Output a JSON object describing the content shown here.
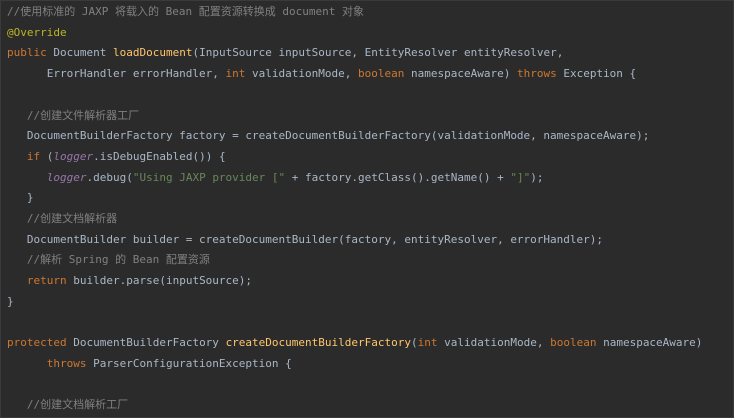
{
  "editor": {
    "colors": {
      "background": "#2b2b2b",
      "plain": "#a9b7c6",
      "comment": "#808080",
      "keyword": "#cc7832",
      "annotation": "#bbb529",
      "method": "#ffc66d",
      "string": "#6a8759",
      "field": "#9876aa"
    },
    "lines": [
      {
        "tokens": [
          {
            "t": "comment",
            "v": "//使用标准的 JAXP 将载入的 Bean 配置资源转换成 document 对象"
          }
        ]
      },
      {
        "tokens": [
          {
            "t": "annotation",
            "v": "@Override"
          }
        ]
      },
      {
        "tokens": [
          {
            "t": "keyword",
            "v": "public "
          },
          {
            "t": "plain",
            "v": "Document "
          },
          {
            "t": "method",
            "v": "loadDocument"
          },
          {
            "t": "plain",
            "v": "(InputSource inputSource, EntityResolver entityResolver,"
          }
        ]
      },
      {
        "tokens": [
          {
            "t": "plain",
            "v": "      ErrorHandler errorHandler, "
          },
          {
            "t": "keyword",
            "v": "int "
          },
          {
            "t": "plain",
            "v": "validationMode, "
          },
          {
            "t": "keyword",
            "v": "boolean "
          },
          {
            "t": "plain",
            "v": "namespaceAware) "
          },
          {
            "t": "keyword",
            "v": "throws "
          },
          {
            "t": "plain",
            "v": "Exception {"
          }
        ]
      },
      {
        "tokens": []
      },
      {
        "tokens": [
          {
            "t": "comment",
            "v": "   //创建文件解析器工厂"
          }
        ]
      },
      {
        "tokens": [
          {
            "t": "plain",
            "v": "   DocumentBuilderFactory factory = createDocumentBuilderFactory(validationMode, namespaceAware);"
          }
        ]
      },
      {
        "tokens": [
          {
            "t": "keyword",
            "v": "   if "
          },
          {
            "t": "plain",
            "v": "("
          },
          {
            "t": "field",
            "v": "logger"
          },
          {
            "t": "plain",
            "v": ".isDebugEnabled()) {"
          }
        ]
      },
      {
        "tokens": [
          {
            "t": "field",
            "v": "      logger"
          },
          {
            "t": "plain",
            "v": ".debug("
          },
          {
            "t": "string",
            "v": "\"Using JAXP provider [\""
          },
          {
            "t": "plain",
            "v": " + factory.getClass().getName() + "
          },
          {
            "t": "string",
            "v": "\"]\""
          },
          {
            "t": "plain",
            "v": ");"
          }
        ]
      },
      {
        "tokens": [
          {
            "t": "plain",
            "v": "   }"
          }
        ]
      },
      {
        "tokens": [
          {
            "t": "comment",
            "v": "   //创建文档解析器"
          }
        ]
      },
      {
        "tokens": [
          {
            "t": "plain",
            "v": "   DocumentBuilder builder = createDocumentBuilder(factory, entityResolver, errorHandler);"
          }
        ]
      },
      {
        "tokens": [
          {
            "t": "comment",
            "v": "   //解析 Spring 的 Bean 配置资源"
          }
        ]
      },
      {
        "tokens": [
          {
            "t": "keyword",
            "v": "   return "
          },
          {
            "t": "plain",
            "v": "builder.parse(inputSource);"
          }
        ]
      },
      {
        "tokens": [
          {
            "t": "plain",
            "v": "}"
          }
        ]
      },
      {
        "tokens": []
      },
      {
        "tokens": [
          {
            "t": "keyword",
            "v": "protected "
          },
          {
            "t": "plain",
            "v": "DocumentBuilderFactory "
          },
          {
            "t": "method",
            "v": "createDocumentBuilderFactory"
          },
          {
            "t": "plain",
            "v": "("
          },
          {
            "t": "keyword",
            "v": "int "
          },
          {
            "t": "plain",
            "v": "validationMode, "
          },
          {
            "t": "keyword",
            "v": "boolean "
          },
          {
            "t": "plain",
            "v": "namespaceAware)"
          }
        ]
      },
      {
        "tokens": [
          {
            "t": "keyword",
            "v": "      throws "
          },
          {
            "t": "plain",
            "v": "ParserConfigurationException {"
          }
        ]
      },
      {
        "tokens": []
      },
      {
        "tokens": [
          {
            "t": "comment",
            "v": "   //创建文档解析工厂"
          }
        ]
      }
    ]
  }
}
